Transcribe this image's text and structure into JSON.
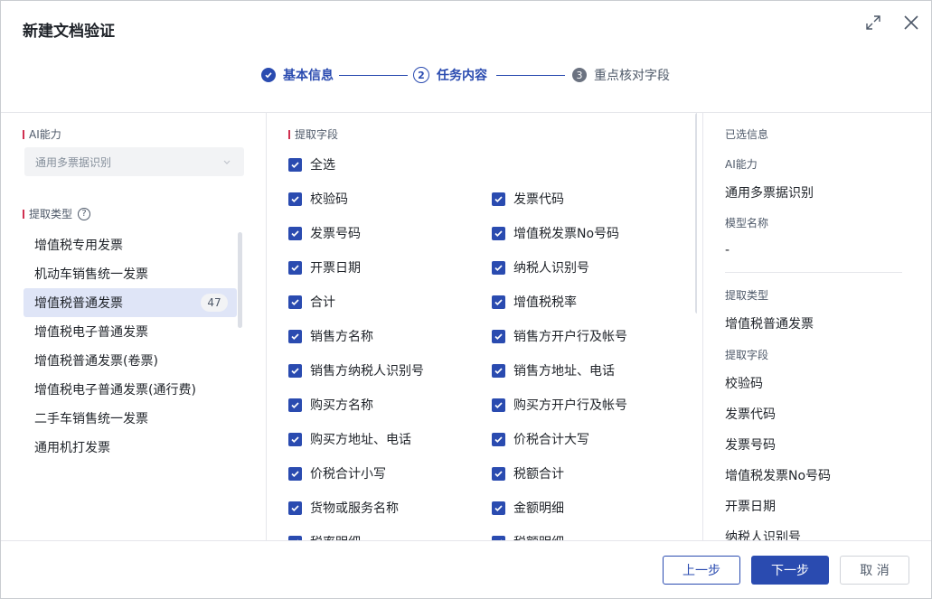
{
  "dialog": {
    "title": "新建文档验证",
    "expand_icon": "expand-icon",
    "close_icon": "close-icon"
  },
  "steps": [
    {
      "number": "",
      "label": "基本信息",
      "state": "done"
    },
    {
      "number": "2",
      "label": "任务内容",
      "state": "active"
    },
    {
      "number": "3",
      "label": "重点核对字段",
      "state": "pending"
    }
  ],
  "colors": {
    "primary": "#2a4bb0",
    "accent_red": "#d03050",
    "active_bg": "#dfe5f7"
  },
  "left": {
    "ai_label": "AI能力",
    "ai_select_value": "通用多票据识别",
    "type_label": "提取类型",
    "help_icon": "question-circle-icon",
    "types": [
      {
        "label": "增值税专用发票",
        "count": ""
      },
      {
        "label": "机动车销售统一发票",
        "count": ""
      },
      {
        "label": "增值税普通发票",
        "count": "47",
        "active": true
      },
      {
        "label": "增值税电子普通发票",
        "count": ""
      },
      {
        "label": "增值税普通发票(卷票)",
        "count": ""
      },
      {
        "label": "增值税电子普通发票(通行费)",
        "count": ""
      },
      {
        "label": "二手车销售统一发票",
        "count": ""
      },
      {
        "label": "通用机打发票",
        "count": ""
      }
    ]
  },
  "middle": {
    "fields_label": "提取字段",
    "select_all": "全选",
    "fields": [
      [
        "校验码",
        "发票代码"
      ],
      [
        "发票号码",
        "增值税发票No号码"
      ],
      [
        "开票日期",
        "纳税人识别号"
      ],
      [
        "合计",
        "增值税税率"
      ],
      [
        "销售方名称",
        "销售方开户行及帐号"
      ],
      [
        "销售方纳税人识别号",
        "销售方地址、电话"
      ],
      [
        "购买方名称",
        "购买方开户行及帐号"
      ],
      [
        "购买方地址、电话",
        "价税合计大写"
      ],
      [
        "价税合计小写",
        "税额合计"
      ],
      [
        "货物或服务名称",
        "金额明细"
      ],
      [
        "税率明细",
        "税额明细"
      ]
    ]
  },
  "right": {
    "title": "已选信息",
    "ai_label": "AI能力",
    "ai_value": "通用多票据识别",
    "model_label": "模型名称",
    "model_value": "-",
    "type_label": "提取类型",
    "type_value": "增值税普通发票",
    "fields_label": "提取字段",
    "fields": [
      "校验码",
      "发票代码",
      "发票号码",
      "增值税发票No号码",
      "开票日期",
      "纳税人识别号"
    ]
  },
  "footer": {
    "prev": "上一步",
    "next": "下一步",
    "cancel": "取 消"
  }
}
